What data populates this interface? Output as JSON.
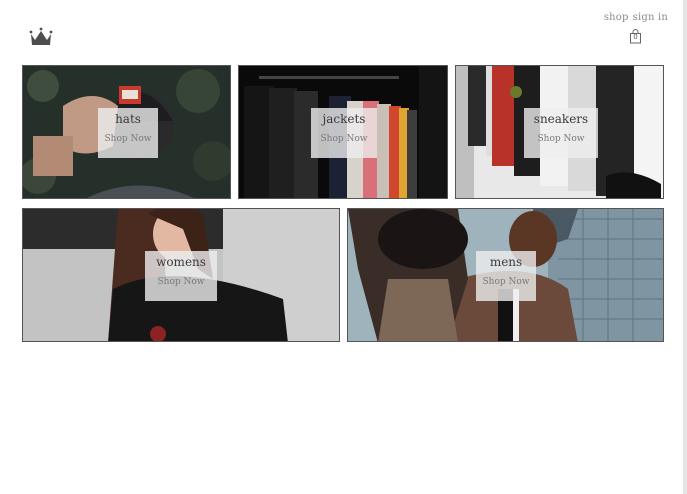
{
  "brand": {
    "logo_icon": "crown-icon"
  },
  "nav": {
    "shop_label": "shop",
    "signin_label": "sign in",
    "cart_icon": "shopping-bag-icon",
    "cart_count": "0"
  },
  "categories": [
    {
      "title": "hats",
      "cta": "Shop Now"
    },
    {
      "title": "jackets",
      "cta": "Shop Now"
    },
    {
      "title": "sneakers",
      "cta": "Shop Now"
    },
    {
      "title": "womens",
      "cta": "Shop Now"
    },
    {
      "title": "mens",
      "cta": "Shop Now"
    }
  ]
}
